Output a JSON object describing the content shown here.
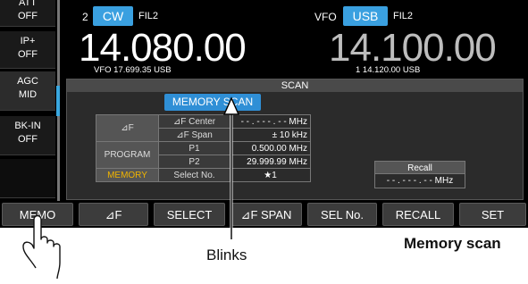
{
  "side_buttons": [
    {
      "title": "ATT",
      "value": "OFF"
    },
    {
      "title": "IP+",
      "value": "OFF"
    },
    {
      "title": "AGC",
      "value": "MID"
    },
    {
      "title": "BK-IN",
      "value": "OFF"
    }
  ],
  "vfo_a": {
    "number": "2",
    "mode": "CW",
    "filter": "FIL2",
    "frequency": "14.080.00",
    "sub_line": "VFO  17.699.35  USB"
  },
  "vfo_b": {
    "label": "VFO",
    "mode": "USB",
    "filter": "FIL2",
    "frequency": "14.100.00",
    "sub_line": "1  14.120.00  USB"
  },
  "scan_panel": {
    "title": "SCAN",
    "scan_type": "MEMORY SCAN",
    "rows": [
      {
        "group": "⊿F",
        "label": "⊿F Center",
        "value": "- - . - - - . - -   MHz"
      },
      {
        "group": "",
        "label": "⊿F Span",
        "value": "±   10   kHz"
      },
      {
        "group": "PROGRAM",
        "label": "P1",
        "value": "0.500.00  MHz"
      },
      {
        "group": "",
        "label": "P2",
        "value": "29.999.99  MHz"
      },
      {
        "group": "MEMORY",
        "label": "Select No.",
        "value": "★1"
      }
    ],
    "recall_title": "Recall",
    "recall_value": "- - . - - - . - -   MHz"
  },
  "soft_keys": [
    "MEMO",
    "⊿F",
    "SELECT",
    "⊿F SPAN",
    "SEL No.",
    "RECALL",
    "SET"
  ],
  "captions": {
    "blinks": "Blinks",
    "section": "Memory scan"
  },
  "colors": {
    "accent_blue": "#3aa0e0",
    "memory_yellow": "#f0b400"
  }
}
